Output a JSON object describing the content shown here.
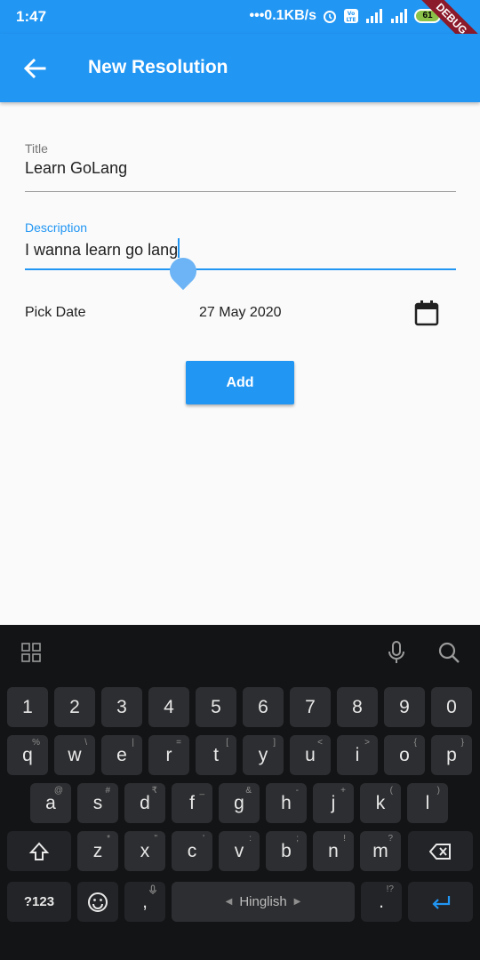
{
  "status": {
    "time": "1:47",
    "speed": "•••0.1KB/s",
    "battery": "61",
    "debug": "DEBUG"
  },
  "appbar": {
    "title": "New Resolution"
  },
  "form": {
    "title": {
      "label": "Title",
      "value": "Learn GoLang"
    },
    "description": {
      "label": "Description",
      "value": "I wanna learn go lang"
    },
    "pick_date": {
      "label": "Pick Date",
      "value": "27 May 2020"
    },
    "add_label": "Add"
  },
  "keyboard": {
    "numbers": [
      "1",
      "2",
      "3",
      "4",
      "5",
      "6",
      "7",
      "8",
      "9",
      "0"
    ],
    "row1": [
      {
        "k": "q",
        "h": "%"
      },
      {
        "k": "w",
        "h": "\\"
      },
      {
        "k": "e",
        "h": "|"
      },
      {
        "k": "r",
        "h": "="
      },
      {
        "k": "t",
        "h": "["
      },
      {
        "k": "y",
        "h": "]"
      },
      {
        "k": "u",
        "h": "<"
      },
      {
        "k": "i",
        "h": ">"
      },
      {
        "k": "o",
        "h": "{"
      },
      {
        "k": "p",
        "h": "}"
      }
    ],
    "row2": [
      {
        "k": "a",
        "h": "@"
      },
      {
        "k": "s",
        "h": "#"
      },
      {
        "k": "d",
        "h": "₹"
      },
      {
        "k": "f",
        "h": "_"
      },
      {
        "k": "g",
        "h": "&"
      },
      {
        "k": "h",
        "h": "-"
      },
      {
        "k": "j",
        "h": "+"
      },
      {
        "k": "k",
        "h": "("
      },
      {
        "k": "l",
        "h": ")"
      }
    ],
    "row3": [
      {
        "k": "z",
        "h": "*"
      },
      {
        "k": "x",
        "h": "\""
      },
      {
        "k": "c",
        "h": "'"
      },
      {
        "k": "v",
        "h": ":"
      },
      {
        "k": "b",
        "h": ";"
      },
      {
        "k": "n",
        "h": "!"
      },
      {
        "k": "m",
        "h": "?"
      }
    ],
    "sym_label": "?123",
    "comma": ",",
    "space_label": "Hinglish",
    "period": ".",
    "period_hint": "!?",
    "accent": "#2196f3"
  }
}
